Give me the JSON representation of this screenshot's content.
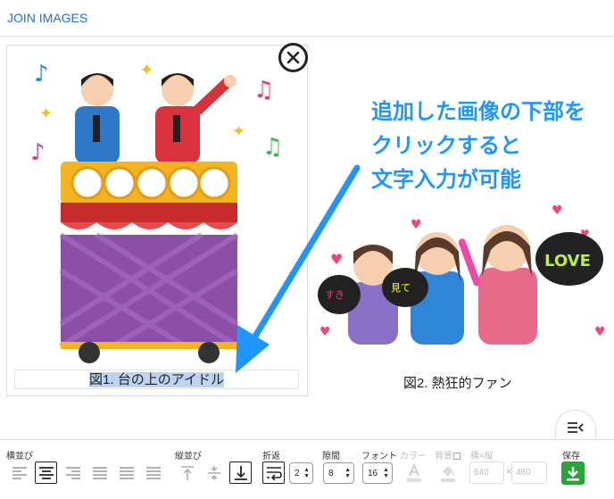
{
  "app": {
    "title": "JOIN IMAGES"
  },
  "images": [
    {
      "caption": "図1. 台の上のアイドル"
    },
    {
      "caption": "図2. 熱狂的ファン"
    }
  ],
  "callout": {
    "lines": [
      "追加した画像の下部を",
      "クリックすると",
      "文字入力が可能"
    ],
    "color": "#1e96ff"
  },
  "toolbar": {
    "horizontal_label": "横並び",
    "vertical_label": "縦並び",
    "wrap_label": "折返",
    "wrap_value": "2",
    "gap_label": "隙間",
    "gap_value": "8",
    "font_label": "フォント",
    "font_value": "16",
    "color_label": "カラー",
    "bg_label": "背景",
    "size_label": "横×縦",
    "width_placeholder": "640",
    "height_placeholder": "480",
    "times_sign": "×",
    "save_label": "保存"
  },
  "colors": {
    "brand": "#1f6fd6",
    "save": "#2aa33b",
    "selection": "#bcd3f2"
  }
}
